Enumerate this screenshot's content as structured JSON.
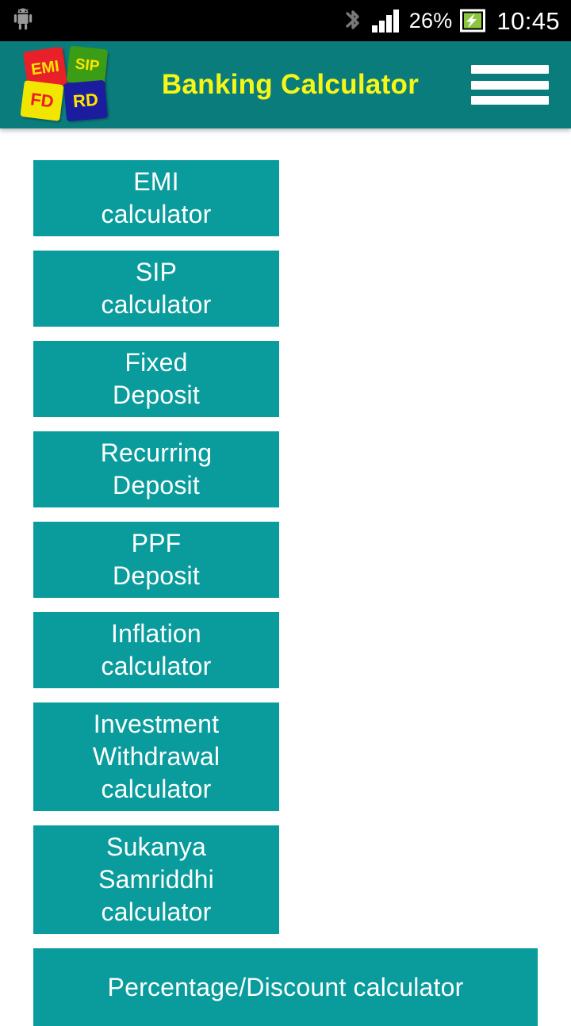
{
  "status_bar": {
    "notification_icon": "android-robot-icon",
    "bluetooth_icon": "bluetooth-icon",
    "signal_icon": "signal-bars-icon",
    "battery_percent": "26%",
    "battery_icon": "battery-charging-icon",
    "time": "10:45",
    "background_color": "#000000",
    "text_color": "#ffffff"
  },
  "app_bar": {
    "title": "Banking Calculator",
    "title_color": "#f7f717",
    "background_color": "#0b7c7c",
    "menu_icon": "hamburger-menu-icon",
    "logo": {
      "name": "banking-calculator-logo",
      "tiles": [
        {
          "label": "EMI",
          "background": "#e8202a",
          "color": "#ffe400"
        },
        {
          "label": "SIP",
          "background": "#3b9c16",
          "color": "#ffe400"
        },
        {
          "label": "FD",
          "background": "#f2e500",
          "color": "#e8202a"
        },
        {
          "label": "RD",
          "background": "#1c1c9e",
          "color": "#ffe400"
        }
      ]
    }
  },
  "main": {
    "background_color": "#ffffff",
    "button_color": "#0a9c9c",
    "button_text_color": "#ffffff",
    "buttons": [
      {
        "id": "emi-calculator",
        "label": "EMI\ncalculator",
        "span": "half",
        "lines": 2
      },
      {
        "id": "sip-calculator",
        "label": "SIP\ncalculator",
        "span": "half",
        "lines": 2
      },
      {
        "id": "fixed-deposit",
        "label": "Fixed\nDeposit",
        "span": "half",
        "lines": 2
      },
      {
        "id": "recurring-deposit",
        "label": "Recurring\nDeposit",
        "span": "half",
        "lines": 2
      },
      {
        "id": "ppf-deposit",
        "label": "PPF\nDeposit",
        "span": "half",
        "lines": 2
      },
      {
        "id": "inflation-calculator",
        "label": "Inflation\ncalculator",
        "span": "half",
        "lines": 2
      },
      {
        "id": "investment-withdrawal-calculator",
        "label": "Investment\nWithdrawal\ncalculator",
        "span": "half",
        "lines": 3
      },
      {
        "id": "sukanya-samriddhi-calculator",
        "label": "Sukanya\nSamriddhi\ncalculator",
        "span": "half",
        "lines": 3
      },
      {
        "id": "percentage-discount-calculator",
        "label": "Percentage/Discount calculator",
        "span": "full",
        "lines": 1
      }
    ]
  }
}
